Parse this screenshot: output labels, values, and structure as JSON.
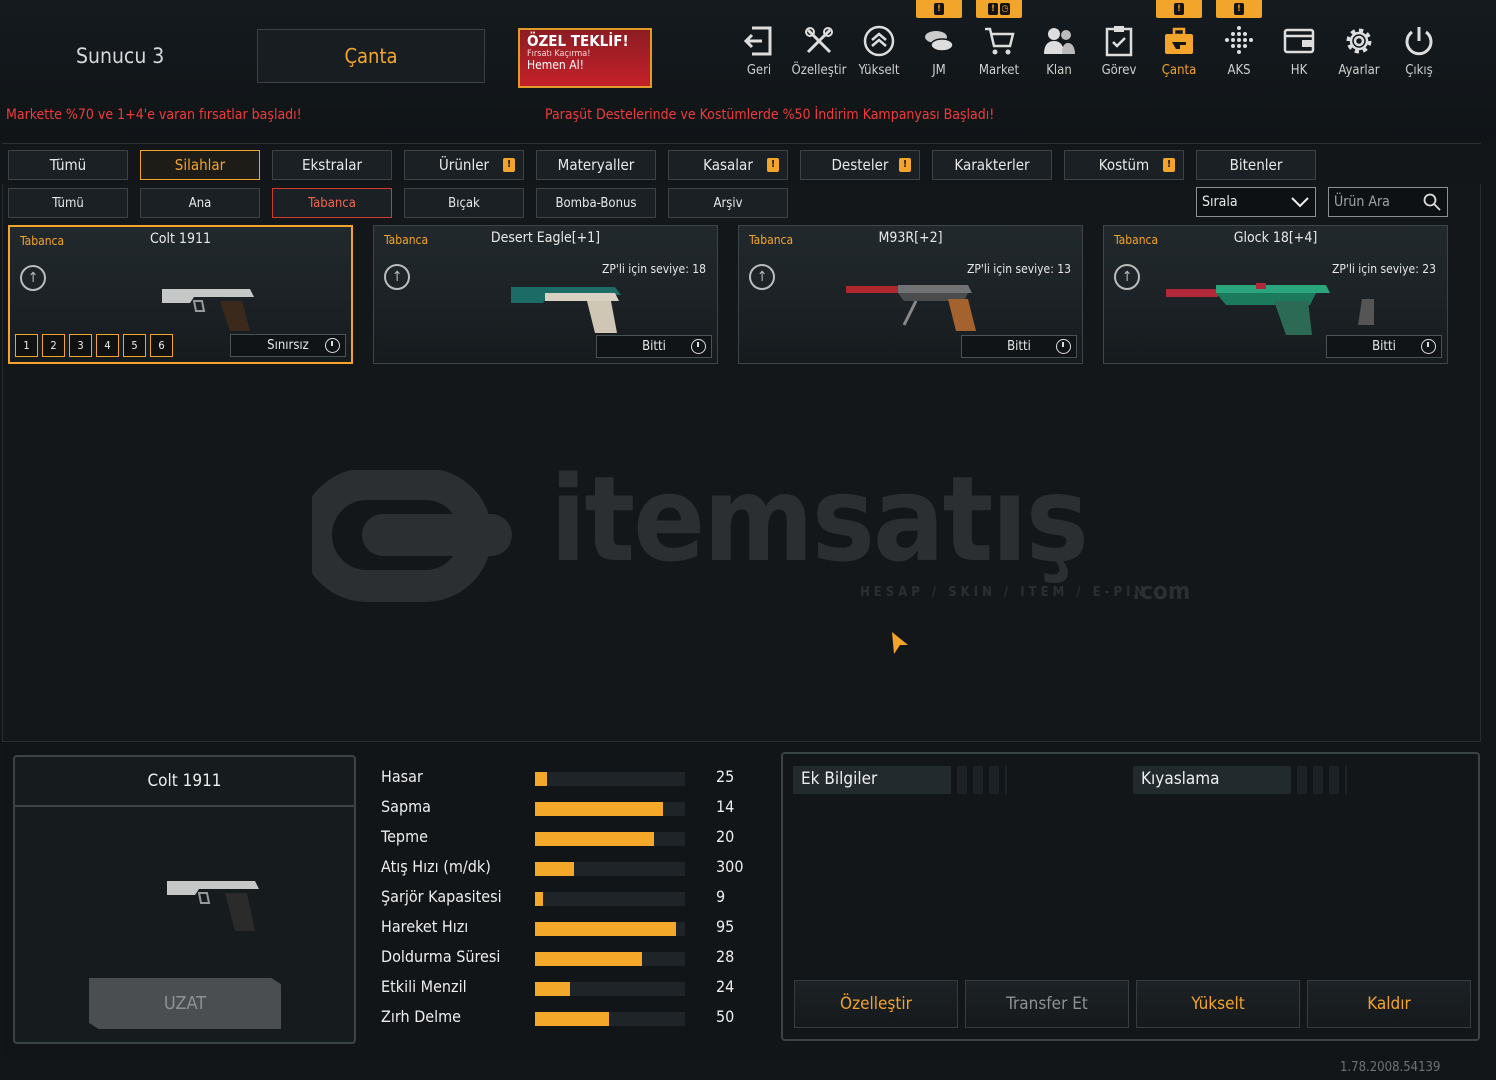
{
  "header": {
    "server": "Sunucu 3",
    "bag_label": "Çanta",
    "offer": {
      "line1": "ÖZEL TEKLİF!",
      "line2": "Fırsatı Kaçırma!",
      "line3": "Hemen Al!"
    },
    "nav": [
      {
        "label": "Geri",
        "icon": "back-icon"
      },
      {
        "label": "Özelleştir",
        "icon": "tools-icon"
      },
      {
        "label": "Yükselt",
        "icon": "rank-up-icon"
      },
      {
        "label": "JM",
        "icon": "coins-icon"
      },
      {
        "label": "Market",
        "icon": "cart-icon"
      },
      {
        "label": "Klan",
        "icon": "clan-icon"
      },
      {
        "label": "Görev",
        "icon": "clipboard-icon"
      },
      {
        "label": "Çanta",
        "icon": "bag-icon"
      },
      {
        "label": "AKS",
        "icon": "dots-grid-icon"
      },
      {
        "label": "HK",
        "icon": "wallet-icon"
      },
      {
        "label": "Ayarlar",
        "icon": "gear-icon"
      },
      {
        "label": "Çıkış",
        "icon": "power-icon"
      }
    ],
    "ticker_left": "Markette %70 ve 1+4'e varan fırsatlar başladı!",
    "ticker_right": "Paraşüt Destelerinde ve Kostümlerde %50 İndirim Kampanyası Başladı!"
  },
  "tabs": [
    "Tümü",
    "Silahlar",
    "Ekstralar",
    "Ürünler",
    "Materyaller",
    "Kasalar",
    "Desteler",
    "Karakterler",
    "Kostüm",
    "Bitenler"
  ],
  "subtabs": [
    "Tümü",
    "Ana",
    "Tabanca",
    "Bıçak",
    "Bomba-Bonus",
    "Arşiv"
  ],
  "sort_label": "Sırala",
  "search_placeholder": "Ürün Ara",
  "items": [
    {
      "category": "Tabanca",
      "name": "Colt 1911",
      "status": "Sınırsız",
      "level": "",
      "slots": [
        "1",
        "2",
        "3",
        "4",
        "5",
        "6"
      ]
    },
    {
      "category": "Tabanca",
      "name": "Desert Eagle[+1]",
      "status": "Bitti",
      "level": "ZP'li için seviye: 18"
    },
    {
      "category": "Tabanca",
      "name": "M93R[+2]",
      "status": "Bitti",
      "level": "ZP'li için seviye: 13"
    },
    {
      "category": "Tabanca",
      "name": "Glock 18[+4]",
      "status": "Bitti",
      "level": "ZP'li için seviye: 23"
    }
  ],
  "watermark": {
    "brand": "itemsatış",
    "tagline": "HESAP / SKIN / ITEM / E-PIN",
    "suffix": ".com"
  },
  "preview": {
    "name": "Colt 1911",
    "button": "UZAT"
  },
  "stats": [
    {
      "name": "Hasar",
      "value": "25",
      "fill": 0.08
    },
    {
      "name": "Sapma",
      "value": "14",
      "fill": 0.85
    },
    {
      "name": "Tepme",
      "value": "20",
      "fill": 0.79
    },
    {
      "name": "Atış Hızı (m/dk)",
      "value": "300",
      "fill": 0.26
    },
    {
      "name": "Şarjör Kapasitesi",
      "value": "9",
      "fill": 0.05
    },
    {
      "name": "Hareket Hızı",
      "value": "95",
      "fill": 0.94
    },
    {
      "name": "Doldurma Süresi",
      "value": "28",
      "fill": 0.71
    },
    {
      "name": "Etkili Menzil",
      "value": "24",
      "fill": 0.23
    },
    {
      "name": "Zırh Delme",
      "value": "50",
      "fill": 0.49
    }
  ],
  "info_tabs": [
    "Ek Bilgiler",
    "Kıyaslama"
  ],
  "actions": [
    "Özelleştir",
    "Transfer Et",
    "Yükselt",
    "Kaldır"
  ],
  "version": "1.78.2008.54139",
  "colors": {
    "accent": "#f3a42a",
    "alert": "#ef3b3b",
    "background": "#121619"
  }
}
